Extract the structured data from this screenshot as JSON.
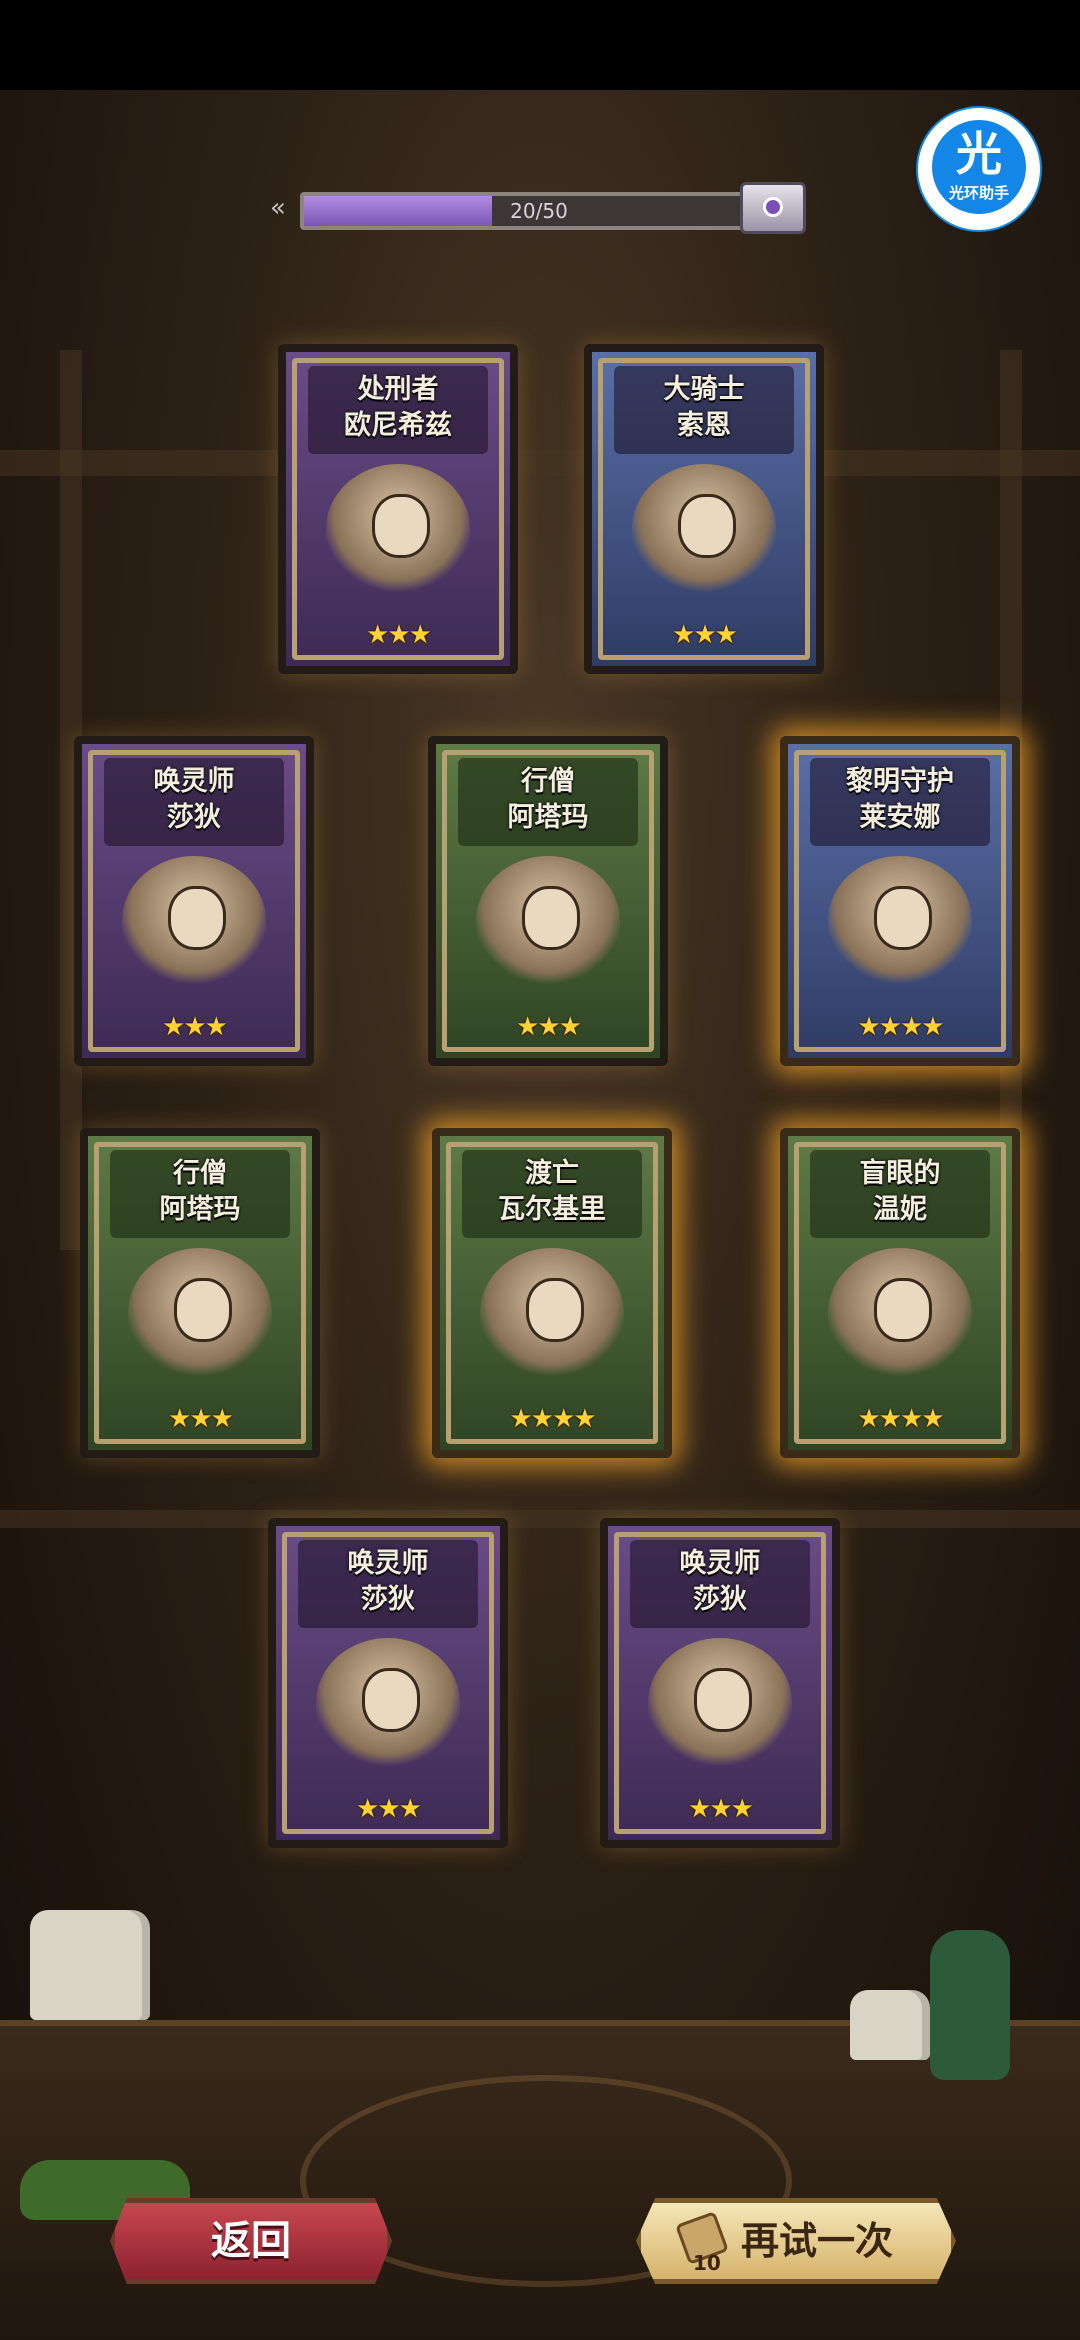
{
  "progress": {
    "text": "20/50",
    "value": 20,
    "max": 50
  },
  "assistant_badge": {
    "glyph": "光",
    "label": "光环助手"
  },
  "cards": [
    {
      "name_line1": "处刑者",
      "name_line2": "欧尼希兹",
      "stars": "★★★",
      "star_count": 3,
      "theme": "purple",
      "highlight": false
    },
    {
      "name_line1": "大骑士",
      "name_line2": "索恩",
      "stars": "★★★",
      "star_count": 3,
      "theme": "blue",
      "highlight": false
    },
    {
      "name_line1": "唤灵师",
      "name_line2": "莎狄",
      "stars": "★★★",
      "star_count": 3,
      "theme": "purple",
      "highlight": false
    },
    {
      "name_line1": "行僧",
      "name_line2": "阿塔玛",
      "stars": "★★★",
      "star_count": 3,
      "theme": "green",
      "highlight": false
    },
    {
      "name_line1": "黎明守护",
      "name_line2": "莱安娜",
      "stars": "★★★★",
      "star_count": 4,
      "theme": "blue",
      "highlight": true
    },
    {
      "name_line1": "行僧",
      "name_line2": "阿塔玛",
      "stars": "★★★",
      "star_count": 3,
      "theme": "green",
      "highlight": false
    },
    {
      "name_line1": "渡亡",
      "name_line2": "瓦尔基里",
      "stars": "★★★★",
      "star_count": 4,
      "theme": "green",
      "highlight": true
    },
    {
      "name_line1": "盲眼的",
      "name_line2": "温妮",
      "stars": "★★★★",
      "star_count": 4,
      "theme": "green",
      "highlight": true
    },
    {
      "name_line1": "唤灵师",
      "name_line2": "莎狄",
      "stars": "★★★",
      "star_count": 3,
      "theme": "purple",
      "highlight": false
    },
    {
      "name_line1": "唤灵师",
      "name_line2": "莎狄",
      "stars": "★★★",
      "star_count": 3,
      "theme": "purple",
      "highlight": false
    }
  ],
  "buttons": {
    "back_label": "返回",
    "retry_label": "再试一次",
    "retry_cost": "10"
  }
}
